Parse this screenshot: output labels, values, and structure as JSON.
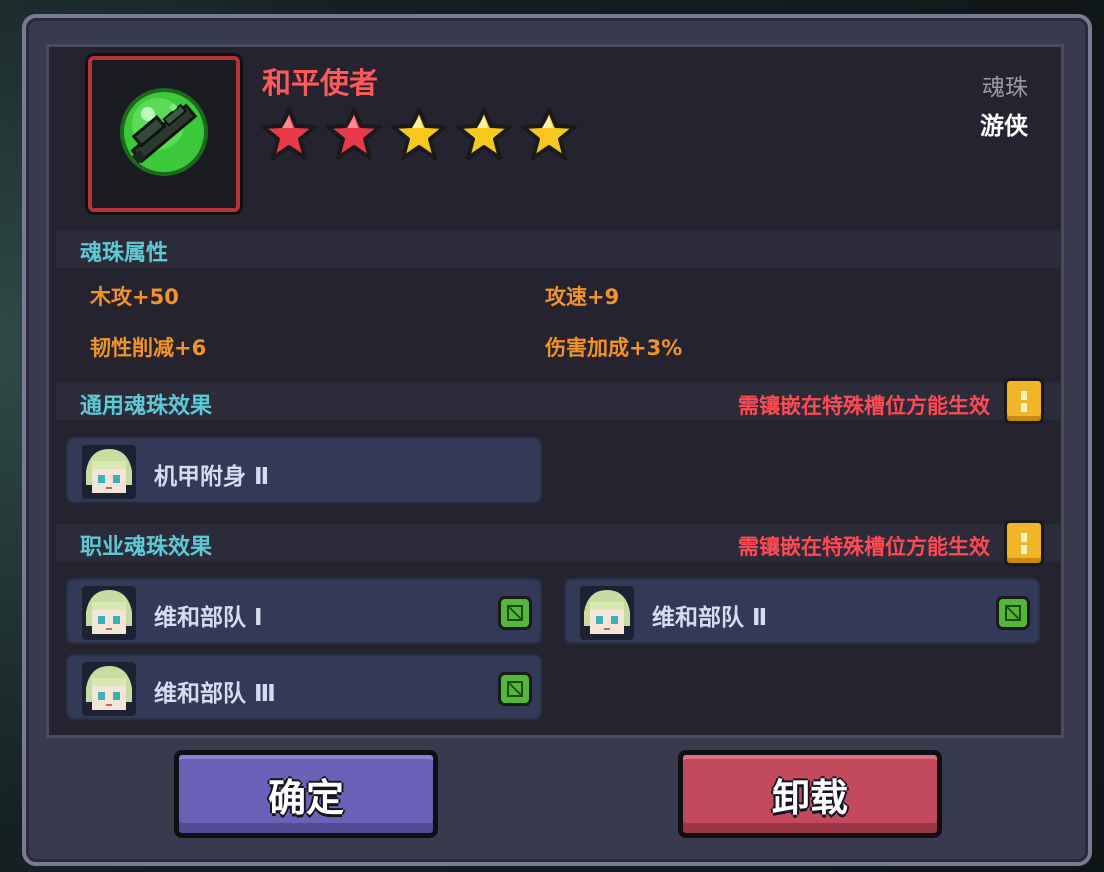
{
  "item": {
    "name": "和平使者",
    "stars_total": 5,
    "stars_red": 2,
    "type": "魂珠",
    "class": "游侠",
    "icon": "green-orb-gun-icon"
  },
  "attributes": {
    "title": "魂珠属性",
    "items": [
      "木攻+50",
      "攻速+9",
      "韧性削减+6",
      "伤害加成+3%"
    ]
  },
  "general_effects": {
    "title": "通用魂珠效果",
    "warning": "需镶嵌在特殊槽位方能生效",
    "items": [
      {
        "label": "机甲附身 Ⅱ"
      }
    ]
  },
  "class_effects": {
    "title": "职业魂珠效果",
    "warning": "需镶嵌在特殊槽位方能生效",
    "items": [
      {
        "label": "维和部队 Ⅰ"
      },
      {
        "label": "维和部队 Ⅱ"
      },
      {
        "label": "维和部队 Ⅲ"
      }
    ]
  },
  "buttons": {
    "confirm": "确定",
    "unload": "卸载"
  },
  "colors": {
    "title": "#ff5a5a",
    "section": "#5ec8d4",
    "attribute": "#f2932a",
    "warning": "#ff4a52",
    "confirm": "#6b62b8",
    "unload": "#c34a5c"
  }
}
